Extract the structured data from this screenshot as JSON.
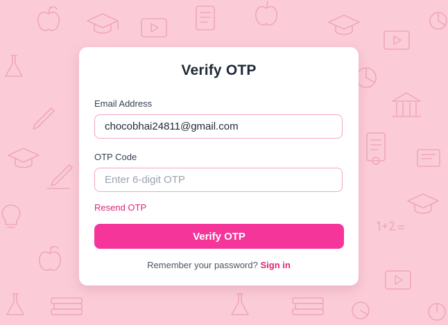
{
  "theme": {
    "background": "#fbccd8",
    "pattern_stroke": "#eea3b8",
    "accent": "#f5359a",
    "link": "#db2777",
    "input_border": "#f5a3c7"
  },
  "background_icons": [
    "apple-icon",
    "graduation-cap-icon",
    "document-icon",
    "video-player-icon",
    "flask-icon",
    "pencil-icon",
    "bank-building-icon",
    "certificate-icon",
    "lightbulb-icon",
    "math-formula-icon",
    "books-icon",
    "pie-chart-icon"
  ],
  "form": {
    "title": "Verify OTP",
    "email_label": "Email Address",
    "email_value": "chocobhai24811@gmail.com",
    "otp_label": "OTP Code",
    "otp_placeholder": "Enter 6-digit OTP",
    "otp_value": "",
    "resend_label": "Resend OTP",
    "submit_label": "Verify OTP",
    "footer_text": "Remember your password?",
    "signin_label": "Sign in"
  }
}
